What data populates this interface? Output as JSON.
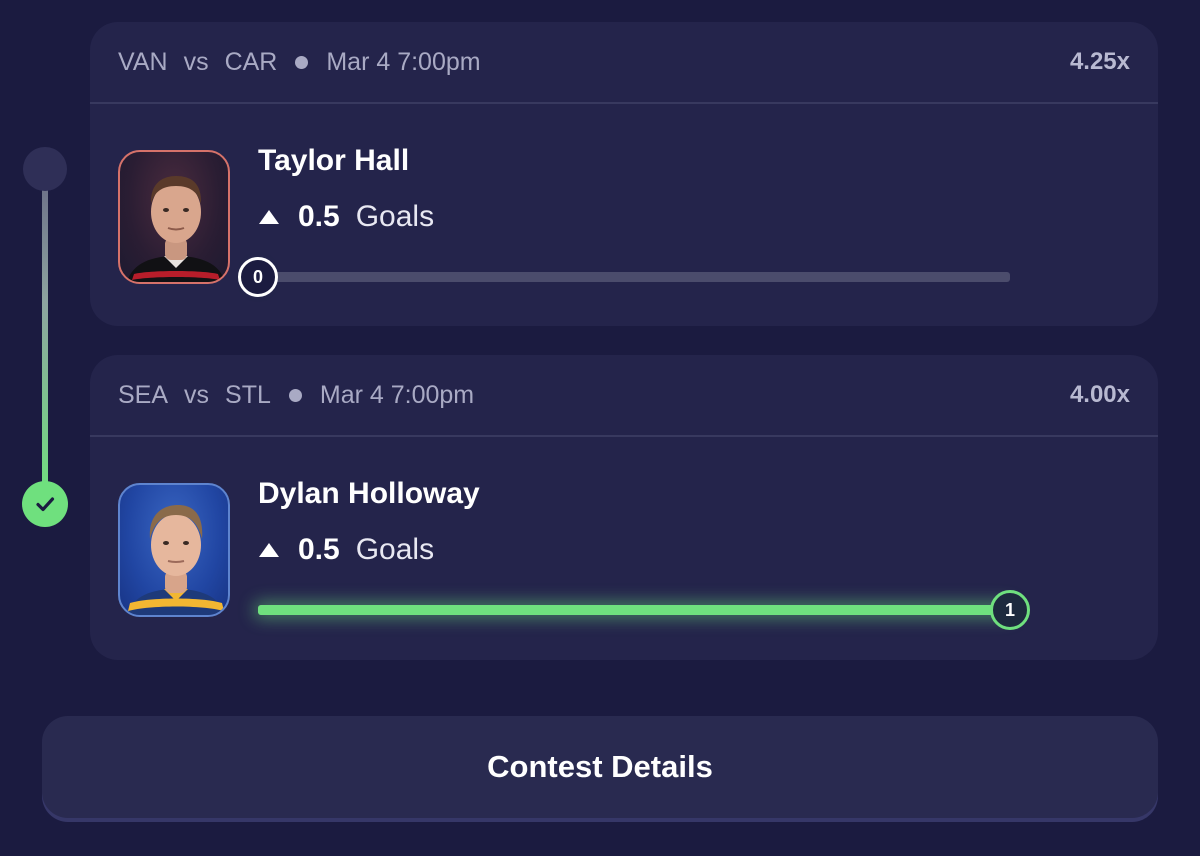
{
  "picks": [
    {
      "home_team": "VAN",
      "vs": "vs",
      "away_team": "CAR",
      "game_time": "Mar 4 7:00pm",
      "multiplier": "4.25x",
      "player_name": "Taylor Hall",
      "direction": "over",
      "line": "0.5",
      "stat_type": "Goals",
      "current_value": "0",
      "progress_fraction": 0,
      "status": "pending"
    },
    {
      "home_team": "SEA",
      "vs": "vs",
      "away_team": "STL",
      "game_time": "Mar 4 7:00pm",
      "multiplier": "4.00x",
      "player_name": "Dylan Holloway",
      "direction": "over",
      "line": "0.5",
      "stat_type": "Goals",
      "current_value": "1",
      "progress_fraction": 1,
      "status": "hit"
    }
  ],
  "contest_button_label": "Contest Details",
  "colors": {
    "background": "#1b1b40",
    "card": "#24244b",
    "accent_green": "#6fe07e",
    "muted_text": "#a9aac4"
  }
}
